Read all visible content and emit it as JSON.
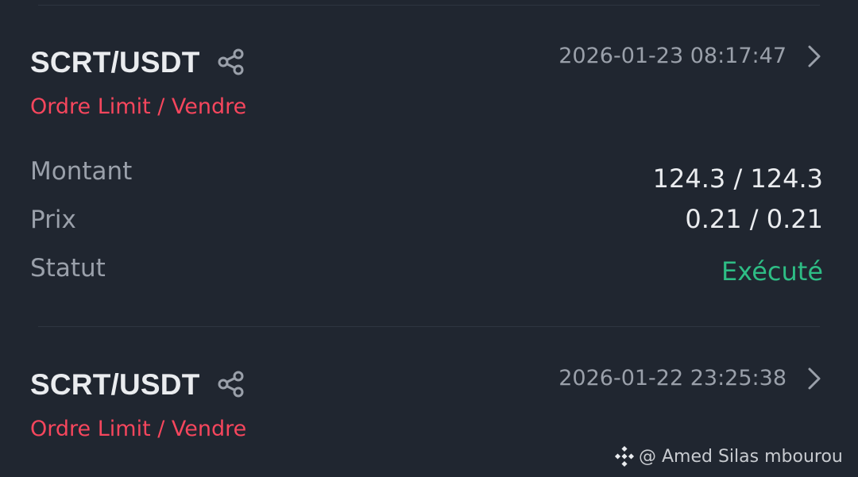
{
  "orders": [
    {
      "pair": "SCRT/USDT",
      "timestamp": "2026-01-23 08:17:47",
      "order_type": "Ordre Limit / Vendre",
      "rows": [
        {
          "label": "Montant",
          "value": "124.3 / 124.3"
        },
        {
          "label": "Prix",
          "value": "0.21 / 0.21"
        },
        {
          "label": "Statut",
          "value": "Exécuté"
        }
      ]
    },
    {
      "pair": "SCRT/USDT",
      "timestamp": "2026-01-22 23:25:38",
      "order_type": "Ordre Limit / Vendre"
    }
  ],
  "watermark": {
    "text": "@ Amed Silas mbourou",
    "icon": "binance-logo-icon"
  },
  "icons": {
    "share": "share-icon",
    "chevron": "chevron-right-icon"
  },
  "colors": {
    "background": "#202630",
    "sell": "#f6465d",
    "executed": "#2ebd85",
    "muted": "#9aa0aa",
    "primary_text": "#eaecef"
  }
}
